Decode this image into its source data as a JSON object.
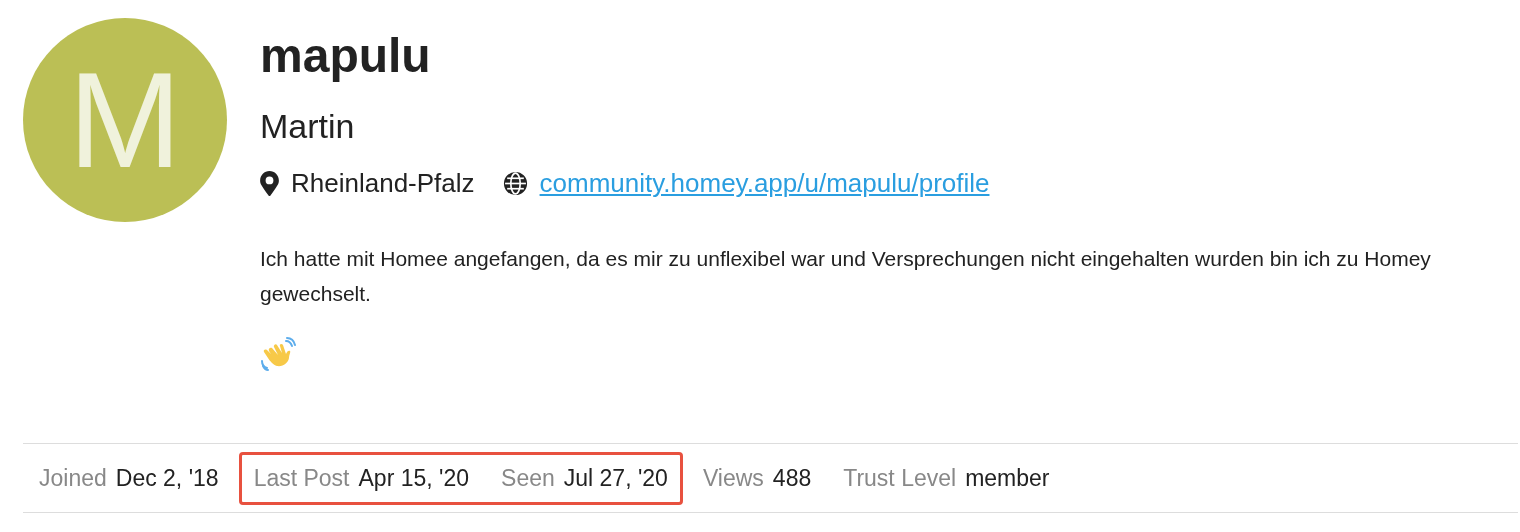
{
  "avatar": {
    "letter": "M",
    "color": "#bbbf55"
  },
  "username": "mapulu",
  "full_name": "Martin",
  "location": "Rheinland-Pfalz",
  "website": "community.homey.app/u/mapulu/profile",
  "bio": "Ich hatte mit Homee angefangen, da es mir zu unflexibel war und Versprechungen nicht eingehalten wurden bin ich zu Homey gewechselt.",
  "stat_groups": [
    {
      "highlighted": false,
      "items": [
        {
          "label": "Joined",
          "value": "Dec 2, '18"
        }
      ]
    },
    {
      "highlighted": true,
      "items": [
        {
          "label": "Last Post",
          "value": "Apr 15, '20"
        },
        {
          "label": "Seen",
          "value": "Jul 27, '20"
        }
      ]
    },
    {
      "highlighted": false,
      "items": [
        {
          "label": "Views",
          "value": "488"
        },
        {
          "label": "Trust Level",
          "value": "member"
        }
      ]
    }
  ]
}
